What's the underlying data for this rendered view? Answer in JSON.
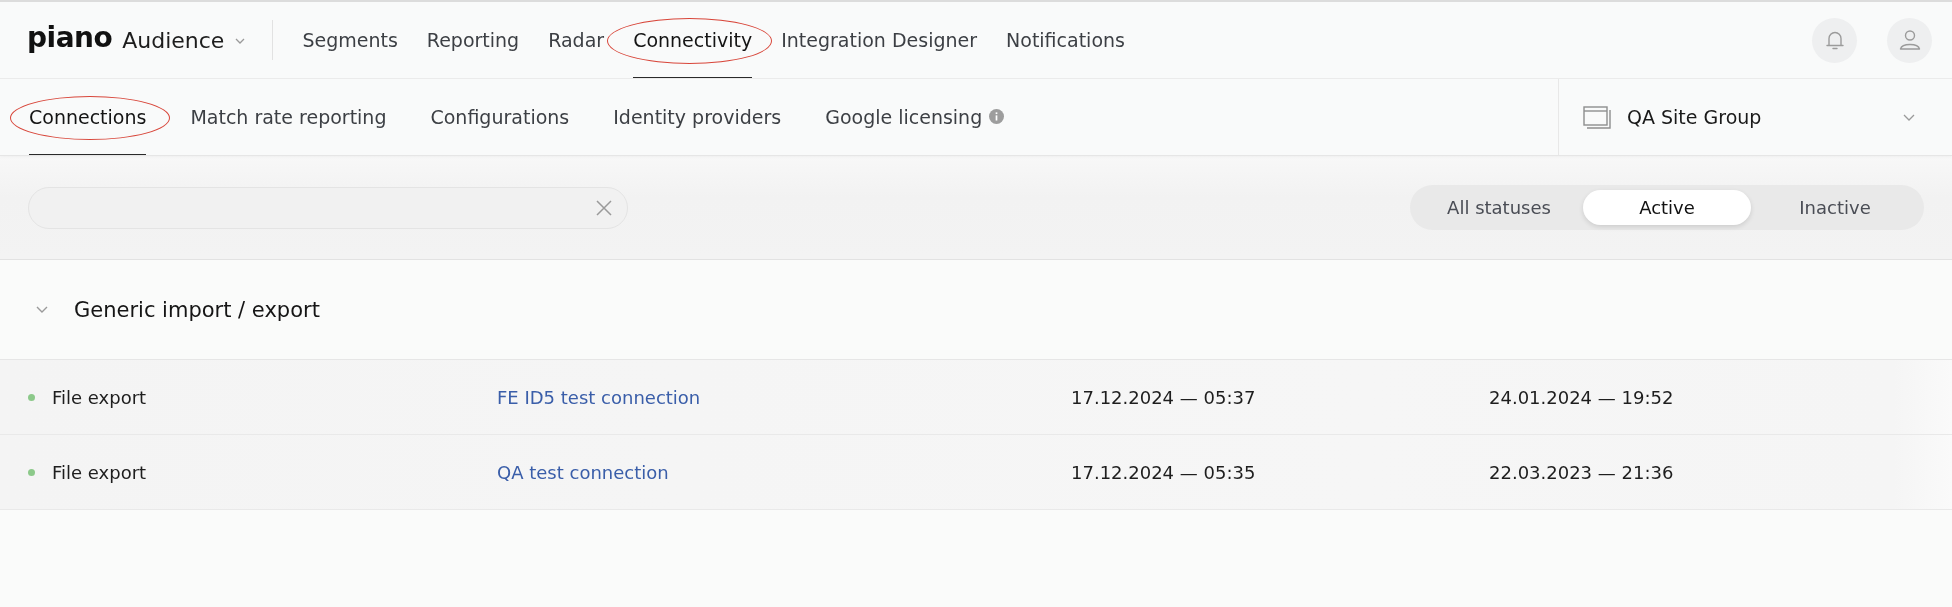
{
  "top_nav": {
    "logo": "piano",
    "product": "Audience",
    "items": [
      {
        "label": "Segments",
        "selected": false,
        "annotated": false
      },
      {
        "label": "Reporting",
        "selected": false,
        "annotated": false
      },
      {
        "label": "Radar",
        "selected": false,
        "annotated": false
      },
      {
        "label": "Connectivity",
        "selected": true,
        "annotated": true
      },
      {
        "label": "Integration Designer",
        "selected": false,
        "annotated": false
      },
      {
        "label": "Notifications",
        "selected": false,
        "annotated": false
      }
    ]
  },
  "sub_nav": {
    "tabs": [
      {
        "label": "Connections",
        "selected": true,
        "annotated": true,
        "info": false
      },
      {
        "label": "Match rate reporting",
        "selected": false,
        "annotated": false,
        "info": false
      },
      {
        "label": "Configurations",
        "selected": false,
        "annotated": false,
        "info": false
      },
      {
        "label": "Identity providers",
        "selected": false,
        "annotated": false,
        "info": false
      },
      {
        "label": "Google licensing",
        "selected": false,
        "annotated": false,
        "info": true
      }
    ],
    "site_group": "QA Site Group"
  },
  "filters": {
    "statuses": [
      {
        "label": "All statuses",
        "selected": false
      },
      {
        "label": "Active",
        "selected": true
      },
      {
        "label": "Inactive",
        "selected": false
      }
    ]
  },
  "groups": [
    {
      "title": "Generic import / export",
      "expanded": true,
      "rows": [
        {
          "color": "#8cc98a",
          "column_1": "File export",
          "column_2": "FE ID5 test connection",
          "column_3": "17.12.2024 — 05:37",
          "column_4": "24.01.2024 — 19:52"
        },
        {
          "color": "#8cc98a",
          "column_1": "File export",
          "column_2": "QA test connection",
          "column_3": "17.12.2024 — 05:35",
          "column_4": "22.03.2023 — 21:36"
        }
      ]
    }
  ]
}
